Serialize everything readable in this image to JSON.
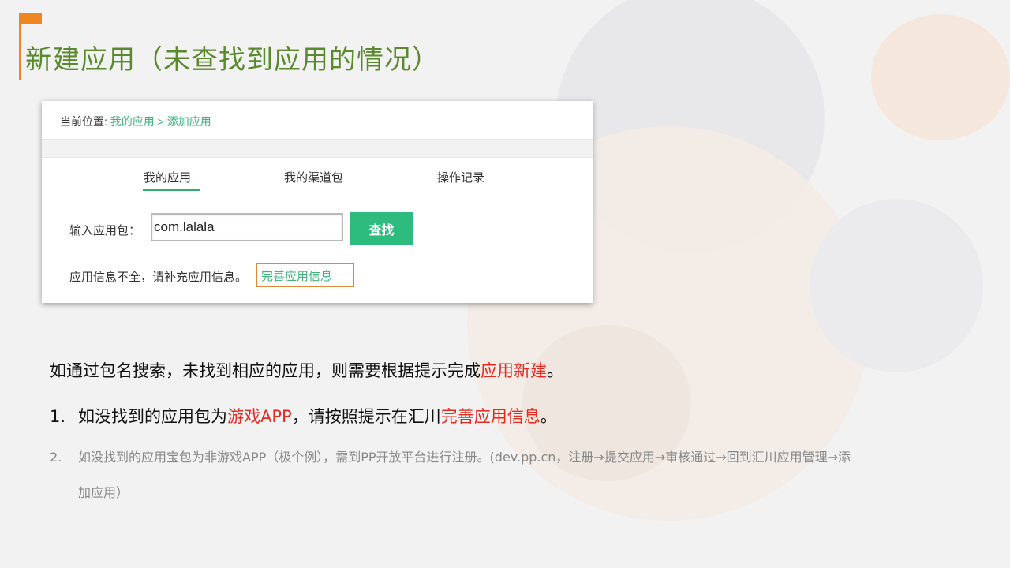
{
  "slide_title": "新建应用（未查找到应用的情况）",
  "panel": {
    "breadcrumb": {
      "prefix": "当前位置: ",
      "link1": "我的应用",
      "separator": " > ",
      "link2": "添加应用"
    },
    "tabs": [
      {
        "label": "我的应用",
        "active": true
      },
      {
        "label": "我的渠道包",
        "active": false
      },
      {
        "label": "操作记录",
        "active": false
      }
    ],
    "input_label": "输入应用包：",
    "input_value": "com.lalala",
    "search_button": "查找",
    "info_text": "应用信息不全，请补充应用信息。",
    "complete_link": "完善应用信息"
  },
  "body": {
    "line1_pre": "如通过包名搜索，未找到相应的应用，则需要根据提示完成",
    "line1_red": "应用新建",
    "line1_post": "。",
    "line2_num": "1.",
    "line2_a": "如没找到的应用包为",
    "line2_red1": "游戏APP",
    "line2_b": "，请按照提示在汇川",
    "line2_red2": "完善应用信息",
    "line2_c": "。",
    "line3_num": "2.",
    "line3_text": "如没找到的应用宝包为非游戏APP（极个例），需到PP开放平台进行注册。(dev.pp.cn，注册→提交应用→审核通过→回到汇川应用管理→添",
    "line4_text": "加应用）"
  },
  "colors": {
    "accent_orange": "#ef8624",
    "title_green": "#5b8a2e",
    "link_green": "#3cb37a",
    "button_green": "#2ebc7e",
    "highlight_red": "#e8281d"
  }
}
